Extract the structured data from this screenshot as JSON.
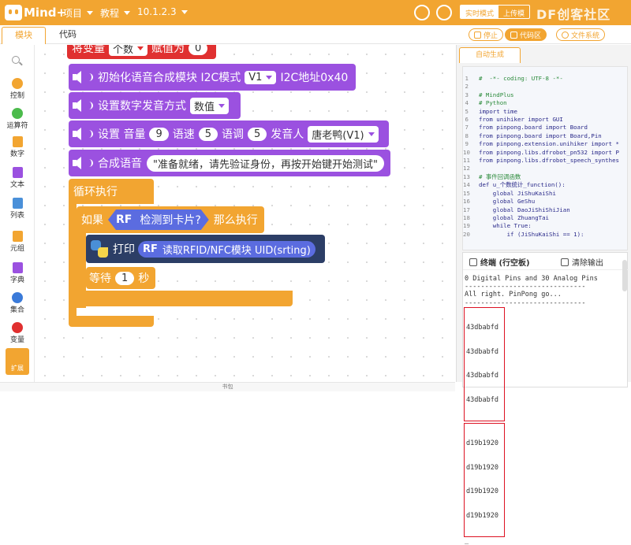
{
  "app": {
    "logo_text": "Mind+",
    "menu": [
      "项目",
      "教程",
      "10.1.2.3"
    ]
  },
  "modes": {
    "realtime": "实时模式",
    "upload": "上传模",
    "watermark": "DF创客社区"
  },
  "tabs": {
    "blocks": "模块",
    "code": "代码"
  },
  "right_buttons": {
    "stop": "停止",
    "code_area": "代码区",
    "file_system": "文件系统"
  },
  "palette": [
    {
      "label": "控制",
      "color": "#f2a531"
    },
    {
      "label": "运算符",
      "color": "#4cbb4c"
    },
    {
      "label": "数字",
      "color": "#f2a531"
    },
    {
      "label": "文本",
      "color": "#9b51e0"
    },
    {
      "label": "列表",
      "color": "#4a90d9"
    },
    {
      "label": "元组",
      "color": "#f2a531"
    },
    {
      "label": "字典",
      "color": "#9b51e0"
    },
    {
      "label": "集合",
      "color": "#3a7ad9"
    },
    {
      "label": "变量",
      "color": "#e03030"
    }
  ],
  "extension_label": "扩展",
  "blocks": {
    "set_var": {
      "a": "将变量",
      "var": "个数",
      "b": "赋值为",
      "val": "0"
    },
    "init": {
      "a": "初始化语音合成模块 I2C模式",
      "ver": "V1",
      "b": "I2C地址0x40"
    },
    "digit_mode": {
      "a": "设置数字发音方式",
      "mode": "数值"
    },
    "voice": {
      "a": "设置 音量",
      "vol": "9",
      "b": "语速",
      "spd": "5",
      "c": "语调",
      "tone": "5",
      "d": "发音人",
      "speaker": "唐老鸭(V1)"
    },
    "synth": {
      "a": "合成语音",
      "text": "\"准备就绪，请先验证身份，再按开始键开始测试\""
    },
    "loop": "循环执行",
    "if_block": {
      "a": "如果",
      "b": "检测到卡片?",
      "c": "那么执行",
      "rf": "RF"
    },
    "print": {
      "a": "打印",
      "rf": "RF",
      "b": "读取RFID/NFC模块 UID(srting)"
    },
    "wait": {
      "a": "等待",
      "val": "1",
      "b": "秒"
    }
  },
  "autogen_tab": "自动生成",
  "code_lines": [
    "#  -*- coding: UTF-8 -*-",
    "",
    "# MindPlus",
    "# Python",
    "import time",
    "from unihiker import GUI",
    "from pinpong.board import Board",
    "from pinpong.board import Board,Pin",
    "from pinpong.extension.unihiker import *",
    "from pinpong.libs.dfrobot_pn532 import P",
    "from pinpong.libs.dfrobot_speech_synthes",
    "",
    "# 事件回调函数",
    "def u_个数统计_function():",
    "    global JiShuKaiShi",
    "    global GeShu",
    "    global DaoJiShiShiJian",
    "    global ZhuangTai",
    "    while True:",
    "        if (JiShuKaiShi == 1):"
  ],
  "terminal": {
    "title": "终端 (行空板)",
    "clear": "清除输出",
    "lines": [
      "0 Digital Pins and 30 Analog Pins",
      "------------------------------",
      "All right. PinPong go...",
      "------------------------------"
    ],
    "uid_group1": [
      "43dbabfd",
      "43dbabfd",
      "43dbabfd",
      "43dbabfd"
    ],
    "uid_group2": [
      "d19b1920",
      "d19b1920",
      "d19b1920",
      "d19b1920"
    ],
    "prompt": "_"
  },
  "bottom_label": "书包"
}
